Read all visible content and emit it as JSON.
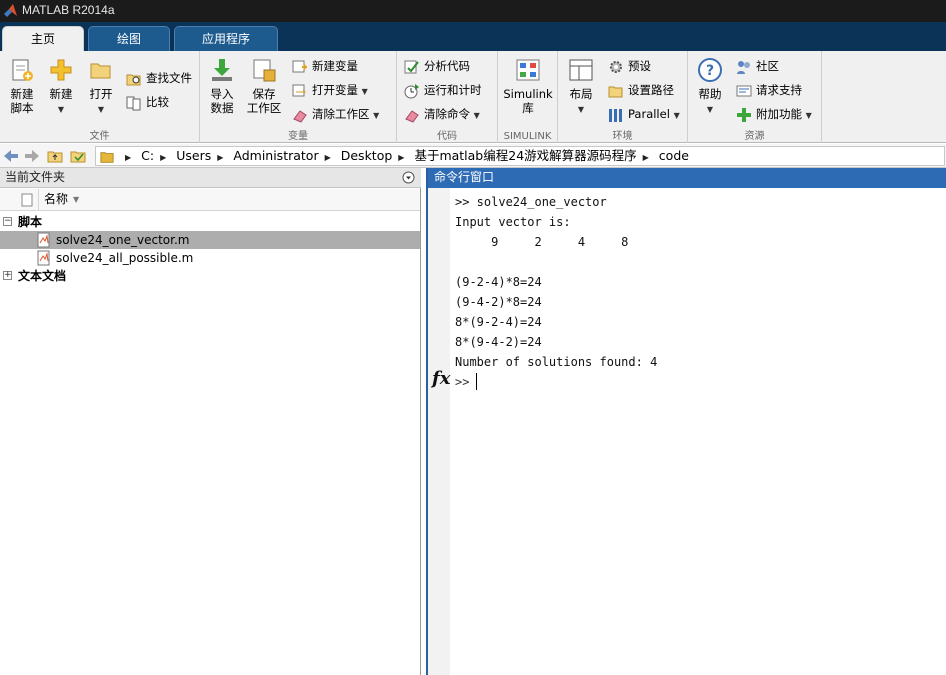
{
  "window": {
    "title": "MATLAB R2014a"
  },
  "tabs": [
    {
      "label": "主页"
    },
    {
      "label": "绘图"
    },
    {
      "label": "应用程序"
    }
  ],
  "ribbon": {
    "file": {
      "group_label": "文件",
      "new_script": "新建\n脚本",
      "new": "新建",
      "open": "打开",
      "find_files": "查找文件",
      "compare": "比较"
    },
    "variable": {
      "group_label": "变量",
      "import_data": "导入\n数据",
      "save_workspace": "保存\n工作区",
      "new_variable": "新建变量",
      "open_variable": "打开变量",
      "clear_workspace": "清除工作区"
    },
    "code": {
      "group_label": "代码",
      "analyze_code": "分析代码",
      "run_and_time": "运行和计时",
      "clear_commands": "清除命令"
    },
    "simulink": {
      "group_label": "SIMULINK",
      "simulink_library": "Simulink\n库"
    },
    "environment": {
      "group_label": "环境",
      "layout": "布局",
      "preferences": "预设",
      "set_path": "设置路径",
      "parallel": "Parallel"
    },
    "resources": {
      "group_label": "资源",
      "help": "帮助",
      "community": "社区",
      "request_support": "请求支持",
      "add_ons": "附加功能"
    }
  },
  "address": {
    "crumbs": [
      "C:",
      "Users",
      "Administrator",
      "Desktop",
      "基于matlab编程24游戏解算器源码程序",
      "code"
    ]
  },
  "current_folder": {
    "title": "当前文件夹",
    "column_name": "名称",
    "groups": [
      {
        "label": "脚本",
        "expanded": true,
        "items": [
          "solve24_one_vector.m",
          "solve24_all_possible.m"
        ]
      },
      {
        "label": "文本文档",
        "expanded": false,
        "items": []
      }
    ],
    "selected_item": "solve24_one_vector.m"
  },
  "command_window": {
    "title": "命令行窗口",
    "lines": [
      ">> solve24_one_vector",
      "Input vector is:",
      "     9     2     4     8",
      "",
      "(9-2-4)*8=24",
      "(9-4-2)*8=24",
      "8*(9-2-4)=24",
      "8*(9-4-2)=24",
      "Number of solutions found: 4"
    ],
    "prompt": ">>",
    "fx_label": "fx"
  }
}
